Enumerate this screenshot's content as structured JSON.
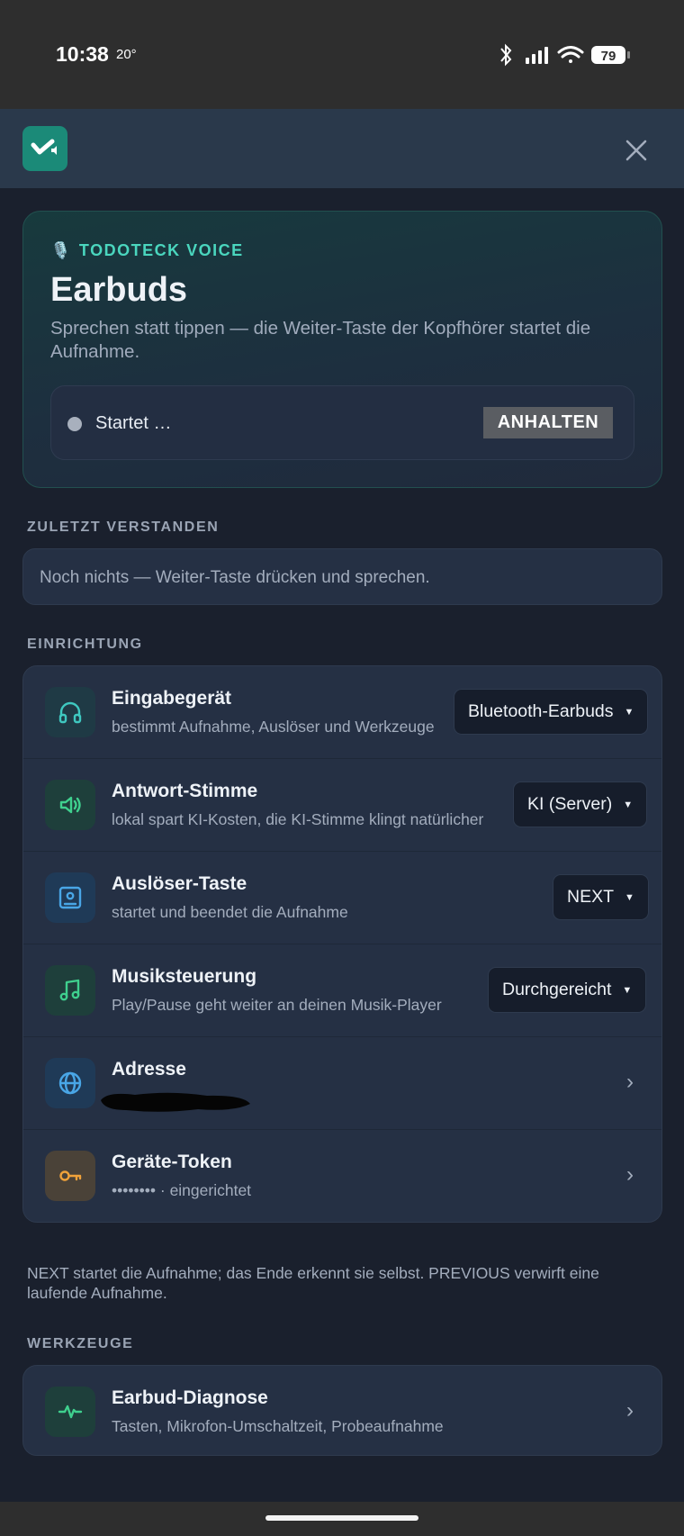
{
  "status_bar": {
    "time": "10:38",
    "temperature": "20°",
    "battery": "79",
    "icons": [
      "bluetooth-icon",
      "signal-icon",
      "wifi-icon",
      "battery-icon"
    ]
  },
  "app_bar": {
    "logo_icon": "check-speaker-icon",
    "close_icon": "close-icon"
  },
  "hero": {
    "eyebrow_icon": "🎙️",
    "eyebrow": "TODOTECK VOICE",
    "title": "Earbuds",
    "description": "Sprechen statt tippen — die Weiter-Taste der Kopfhörer startet die Aufnahme.",
    "status_text": "Startet …",
    "stop_button": "ANHALTEN"
  },
  "last_understood": {
    "label": "ZULETZT VERSTANDEN",
    "text": "Noch nichts — Weiter-Taste drücken und sprechen."
  },
  "setup": {
    "label": "EINRICHTUNG",
    "rows": [
      {
        "title": "Eingabegerät",
        "subtitle": "bestimmt Aufnahme, Auslöser und Werkzeuge",
        "value": "Bluetooth-Earbuds",
        "icon": "headphones-icon"
      },
      {
        "title": "Antwort-Stimme",
        "subtitle": "lokal spart KI-Kosten, die KI-Stimme klingt natürlicher",
        "value": "KI (Server)",
        "icon": "speaker-icon"
      },
      {
        "title": "Auslöser-Taste",
        "subtitle": "startet und beendet die Aufnahme",
        "value": "NEXT",
        "icon": "button-square-icon"
      },
      {
        "title": "Musiksteuerung",
        "subtitle": "Play/Pause geht weiter an deinen Musik-Player",
        "value": "Durchgereicht",
        "icon": "music-note-icon"
      },
      {
        "title": "Adresse",
        "subtitle": "",
        "icon": "globe-icon"
      },
      {
        "title": "Geräte-Token",
        "subtitle": "•••••••• · eingerichtet",
        "icon": "key-icon"
      }
    ],
    "note": "NEXT startet die Aufnahme; das Ende erkennt sie selbst. PREVIOUS verwirft eine laufende Aufnahme."
  },
  "tools": {
    "label": "WERKZEUGE",
    "items": [
      {
        "title": "Earbud-Diagnose",
        "subtitle": "Tasten, Mikrofon-Umschaltzeit, Probeaufnahme",
        "icon": "pulse-icon"
      }
    ]
  },
  "colors": {
    "background": "#1a202d",
    "card": "#253044",
    "accent": "#4ad6be",
    "header": "#2a394b"
  }
}
